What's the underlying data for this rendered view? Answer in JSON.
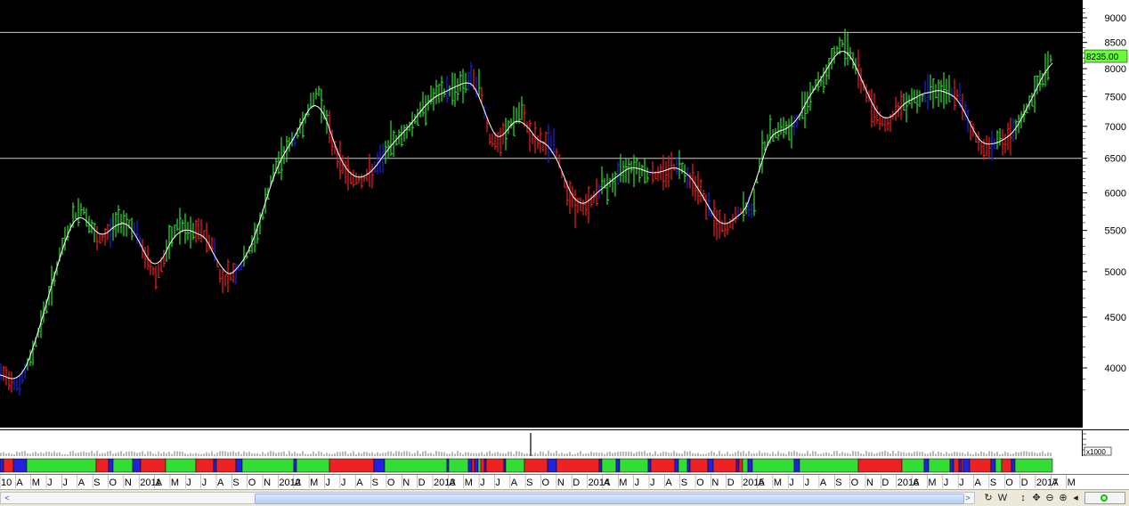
{
  "chart_data": {
    "type": "bar",
    "subtype": "price-bars-with-moving-average",
    "y_axis": {
      "ticks": [
        4000,
        4500,
        5000,
        5500,
        6000,
        6500,
        7000,
        7500,
        8000,
        8500,
        9000
      ],
      "range": [
        3700,
        9300
      ],
      "scale": "log"
    },
    "last_price_label": "8235.00",
    "horizontal_lines": [
      8700,
      6500
    ],
    "colors": {
      "up": "#33dd33",
      "down": "#ee2222",
      "neutral": "#2222dd",
      "ma_line": "#ffffff",
      "background": "#000000"
    },
    "volume_multiplier_label": "x1000",
    "price_path": [
      [
        0,
        3950
      ],
      [
        12,
        3900
      ],
      [
        22,
        3850
      ],
      [
        35,
        4100
      ],
      [
        48,
        4500
      ],
      [
        60,
        4900
      ],
      [
        72,
        5350
      ],
      [
        82,
        5650
      ],
      [
        92,
        5800
      ],
      [
        100,
        5600
      ],
      [
        110,
        5350
      ],
      [
        120,
        5450
      ],
      [
        135,
        5650
      ],
      [
        150,
        5550
      ],
      [
        162,
        5200
      ],
      [
        175,
        4950
      ],
      [
        188,
        5250
      ],
      [
        200,
        5600
      ],
      [
        212,
        5450
      ],
      [
        225,
        5500
      ],
      [
        240,
        5300
      ],
      [
        248,
        4900
      ],
      [
        258,
        4950
      ],
      [
        270,
        5050
      ],
      [
        285,
        5350
      ],
      [
        295,
        5700
      ],
      [
        305,
        6200
      ],
      [
        315,
        6500
      ],
      [
        325,
        6700
      ],
      [
        335,
        6900
      ],
      [
        350,
        7400
      ],
      [
        358,
        7600
      ],
      [
        368,
        7000
      ],
      [
        380,
        6500
      ],
      [
        395,
        6200
      ],
      [
        410,
        6200
      ],
      [
        425,
        6400
      ],
      [
        440,
        6750
      ],
      [
        455,
        6900
      ],
      [
        470,
        7200
      ],
      [
        482,
        7450
      ],
      [
        495,
        7550
      ],
      [
        510,
        7650
      ],
      [
        520,
        7750
      ],
      [
        532,
        7800
      ],
      [
        540,
        7600
      ],
      [
        550,
        6800
      ],
      [
        560,
        6700
      ],
      [
        572,
        7000
      ],
      [
        585,
        7250
      ],
      [
        598,
        6800
      ],
      [
        610,
        6700
      ],
      [
        622,
        6750
      ],
      [
        632,
        6200
      ],
      [
        645,
        5850
      ],
      [
        655,
        5800
      ],
      [
        665,
        5900
      ],
      [
        675,
        6100
      ],
      [
        690,
        6150
      ],
      [
        700,
        6350
      ],
      [
        712,
        6400
      ],
      [
        725,
        6300
      ],
      [
        738,
        6250
      ],
      [
        750,
        6350
      ],
      [
        765,
        6400
      ],
      [
        775,
        6200
      ],
      [
        785,
        6100
      ],
      [
        795,
        5800
      ],
      [
        805,
        5600
      ],
      [
        815,
        5500
      ],
      [
        825,
        5650
      ],
      [
        835,
        5800
      ],
      [
        845,
        5750
      ],
      [
        855,
        6600
      ],
      [
        865,
        6850
      ],
      [
        878,
        7000
      ],
      [
        890,
        6900
      ],
      [
        902,
        7300
      ],
      [
        915,
        7700
      ],
      [
        925,
        7800
      ],
      [
        935,
        8200
      ],
      [
        945,
        8500
      ],
      [
        955,
        8300
      ],
      [
        965,
        7900
      ],
      [
        975,
        7500
      ],
      [
        985,
        7200
      ],
      [
        995,
        7000
      ],
      [
        1005,
        7200
      ],
      [
        1015,
        7400
      ],
      [
        1025,
        7500
      ],
      [
        1035,
        7450
      ],
      [
        1045,
        7700
      ],
      [
        1055,
        7550
      ],
      [
        1068,
        7600
      ],
      [
        1080,
        7400
      ],
      [
        1090,
        7000
      ],
      [
        1100,
        6700
      ],
      [
        1110,
        6650
      ],
      [
        1120,
        6800
      ],
      [
        1130,
        6750
      ],
      [
        1140,
        6900
      ],
      [
        1150,
        7200
      ],
      [
        1160,
        7500
      ],
      [
        1170,
        7800
      ],
      [
        1180,
        8200
      ]
    ],
    "band_segments": [
      [
        "blue",
        0,
        4
      ],
      [
        "red",
        4,
        15
      ],
      [
        "blue",
        15,
        30
      ],
      [
        "green",
        30,
        108
      ],
      [
        "red",
        108,
        122
      ],
      [
        "blue",
        122,
        127
      ],
      [
        "green",
        127,
        149
      ],
      [
        "blue",
        149,
        158
      ],
      [
        "red",
        158,
        186
      ],
      [
        "green",
        186,
        220
      ],
      [
        "red",
        220,
        240
      ],
      [
        "blue",
        240,
        243
      ],
      [
        "red",
        243,
        265
      ],
      [
        "blue",
        265,
        272
      ],
      [
        "green",
        272,
        330
      ],
      [
        "blue",
        330,
        333
      ],
      [
        "green",
        333,
        370
      ],
      [
        "red",
        370,
        420
      ],
      [
        "blue",
        420,
        432
      ],
      [
        "green",
        432,
        502
      ],
      [
        "blue",
        502,
        504
      ],
      [
        "green",
        504,
        526
      ],
      [
        "blue",
        526,
        530
      ],
      [
        "red",
        530,
        533
      ],
      [
        "blue",
        533,
        537
      ],
      [
        "green",
        537,
        540
      ],
      [
        "red",
        540,
        544
      ],
      [
        "blue",
        544,
        546
      ],
      [
        "red",
        546,
        566
      ],
      [
        "blue",
        566,
        568
      ],
      [
        "green",
        568,
        589
      ],
      [
        "red",
        589,
        615
      ],
      [
        "blue",
        615,
        625
      ],
      [
        "red",
        625,
        673
      ],
      [
        "blue",
        673,
        676
      ],
      [
        "green",
        676,
        692
      ],
      [
        "blue",
        692,
        696
      ],
      [
        "green",
        696,
        728
      ],
      [
        "blue",
        728,
        731
      ],
      [
        "red",
        731,
        758
      ],
      [
        "blue",
        758,
        762
      ],
      [
        "green",
        762,
        772
      ],
      [
        "blue",
        772,
        775
      ],
      [
        "red",
        775,
        795
      ],
      [
        "blue",
        795,
        801
      ],
      [
        "red",
        801,
        827
      ],
      [
        "blue",
        827,
        830
      ],
      [
        "red",
        830,
        834
      ],
      [
        "green",
        834,
        840
      ],
      [
        "blue",
        840,
        845
      ],
      [
        "green",
        845,
        892
      ],
      [
        "blue",
        892,
        898
      ],
      [
        "green",
        898,
        964
      ],
      [
        "red",
        964,
        1013
      ],
      [
        "green",
        1013,
        1038
      ],
      [
        "blue",
        1038,
        1043
      ],
      [
        "green",
        1043,
        1067
      ],
      [
        "blue",
        1067,
        1071
      ],
      [
        "red",
        1071,
        1077
      ],
      [
        "blue",
        1077,
        1080
      ],
      [
        "red",
        1080,
        1082
      ],
      [
        "blue",
        1082,
        1089
      ],
      [
        "red",
        1089,
        1113
      ],
      [
        "blue",
        1113,
        1118
      ],
      [
        "green",
        1118,
        1125
      ],
      [
        "red",
        1125,
        1136
      ],
      [
        "blue",
        1136,
        1140
      ],
      [
        "green",
        1140,
        1182
      ]
    ],
    "volume_spikes": [
      [
        596,
        26
      ]
    ],
    "time_axis": [
      {
        "label": "10"
      },
      {
        "label": "A"
      },
      {
        "label": "M"
      },
      {
        "label": "J"
      },
      {
        "label": "J"
      },
      {
        "label": "A"
      },
      {
        "label": "S"
      },
      {
        "label": "O"
      },
      {
        "label": "N"
      },
      {
        "label": "2011"
      },
      {
        "label": "A"
      },
      {
        "label": "M"
      },
      {
        "label": "J"
      },
      {
        "label": "J"
      },
      {
        "label": "A"
      },
      {
        "label": "S"
      },
      {
        "label": "O"
      },
      {
        "label": "N"
      },
      {
        "label": "2012"
      },
      {
        "label": "A"
      },
      {
        "label": "M"
      },
      {
        "label": "J"
      },
      {
        "label": "J"
      },
      {
        "label": "A"
      },
      {
        "label": "S"
      },
      {
        "label": "O"
      },
      {
        "label": "N"
      },
      {
        "label": "D"
      },
      {
        "label": "2013"
      },
      {
        "label": "A"
      },
      {
        "label": "M"
      },
      {
        "label": "J"
      },
      {
        "label": "J"
      },
      {
        "label": "A"
      },
      {
        "label": "S"
      },
      {
        "label": "O"
      },
      {
        "label": "N"
      },
      {
        "label": "D"
      },
      {
        "label": "2014"
      },
      {
        "label": "A"
      },
      {
        "label": "M"
      },
      {
        "label": "J"
      },
      {
        "label": "J"
      },
      {
        "label": "A"
      },
      {
        "label": "S"
      },
      {
        "label": "O"
      },
      {
        "label": "N"
      },
      {
        "label": "D"
      },
      {
        "label": "2015"
      },
      {
        "label": "A"
      },
      {
        "label": "M"
      },
      {
        "label": "J"
      },
      {
        "label": "J"
      },
      {
        "label": "A"
      },
      {
        "label": "S"
      },
      {
        "label": "O"
      },
      {
        "label": "N"
      },
      {
        "label": "D"
      },
      {
        "label": "2016"
      },
      {
        "label": "A"
      },
      {
        "label": "M"
      },
      {
        "label": "J"
      },
      {
        "label": "J"
      },
      {
        "label": "A"
      },
      {
        "label": "S"
      },
      {
        "label": "O"
      },
      {
        "label": "D"
      },
      {
        "label": "2017"
      },
      {
        "label": "A"
      },
      {
        "label": "M"
      }
    ]
  },
  "toolbar": {
    "scroll_left": "<",
    "scroll_right": ">",
    "w_label": "W"
  }
}
